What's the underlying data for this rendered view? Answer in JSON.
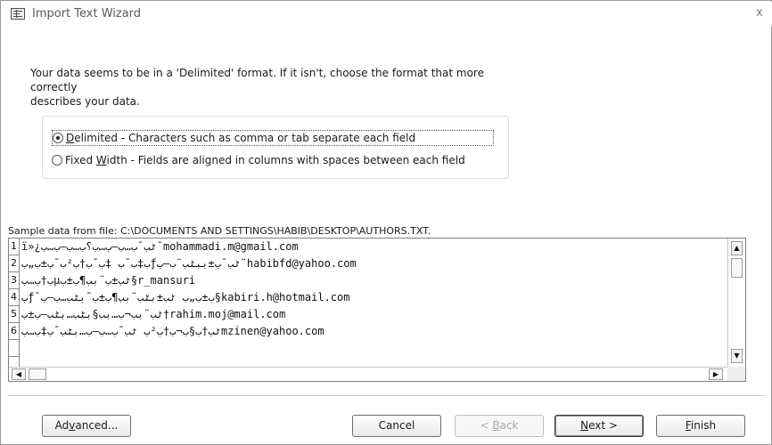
{
  "window": {
    "title": "Import Text Wizard",
    "close_glyph": "x",
    "icon": "wizard-window-icon"
  },
  "intro": {
    "line1": "Your data seems to be in a 'Delimited' format. If it isn't, choose the format that more correctly",
    "line2": "describes your data."
  },
  "format_options": {
    "selected": "delimited",
    "delimited": {
      "access_key": "D",
      "label_rest": "elimited - Characters such as comma or tab separate each field"
    },
    "fixed_width": {
      "label_prefix": "Fixed ",
      "access_key": "W",
      "label_rest": "idth - Fields are aligned in columns with spaces between each field"
    }
  },
  "sample": {
    "label": "Sample data from file: C:\\DOCUMENTS AND SETTINGS\\HABIB\\DESKTOP\\AUTHORS.TXT.",
    "rows": [
      {
        "num": "1",
        "text": "ï»¿ٹب¯ب…ب–ب…ب؟ب…ب–ب…ب¯mohammadi.m@gmail.com"
      },
      {
        "num": "2",
        "text": "ب‡ب¯ب ‡ب¯ب†ب²ب¯ب±ب„بƒٹب¯ب±ببٹب¨ب–ب¨habibfd@yahoo.com"
      },
      {
        "num": "3",
        "text": "ب†ب…بµٹب±ب¨بب¶ب±ب§r_mansuri"
      },
      {
        "num": "4",
        "text": "بƒ¯ب±ب„ب ٹب±بٹب¨بب¶ب±ب¯بٹب…ب–ب§kabiri.h@hotmail.com"
      },
      {
        "num": "5",
        "text": "ٹب¨ب­ب¬ب…بب§بٹب…بٹب–ب±ب†rahim.moj@mail.com"
      },
      {
        "num": "6",
        "text": "ٹب†ب§ب¬ب†ب²ب ٹب¯ب…ب–ب…بٹب¯ب‡ب…بmzinen@yahoo.com"
      }
    ],
    "empty_rows": 2
  },
  "buttons": {
    "advanced": {
      "pre": "Ad",
      "key": "v",
      "post": "anced..."
    },
    "cancel": "Cancel",
    "back": {
      "pre": "< ",
      "key": "B",
      "post": "ack"
    },
    "next": {
      "key": "N",
      "post": "ext >"
    },
    "finish": {
      "key": "F",
      "post": "inish"
    }
  },
  "icons": {
    "scroll_up": "▲",
    "scroll_down": "▼",
    "scroll_left": "◀",
    "scroll_right": "▶"
  }
}
